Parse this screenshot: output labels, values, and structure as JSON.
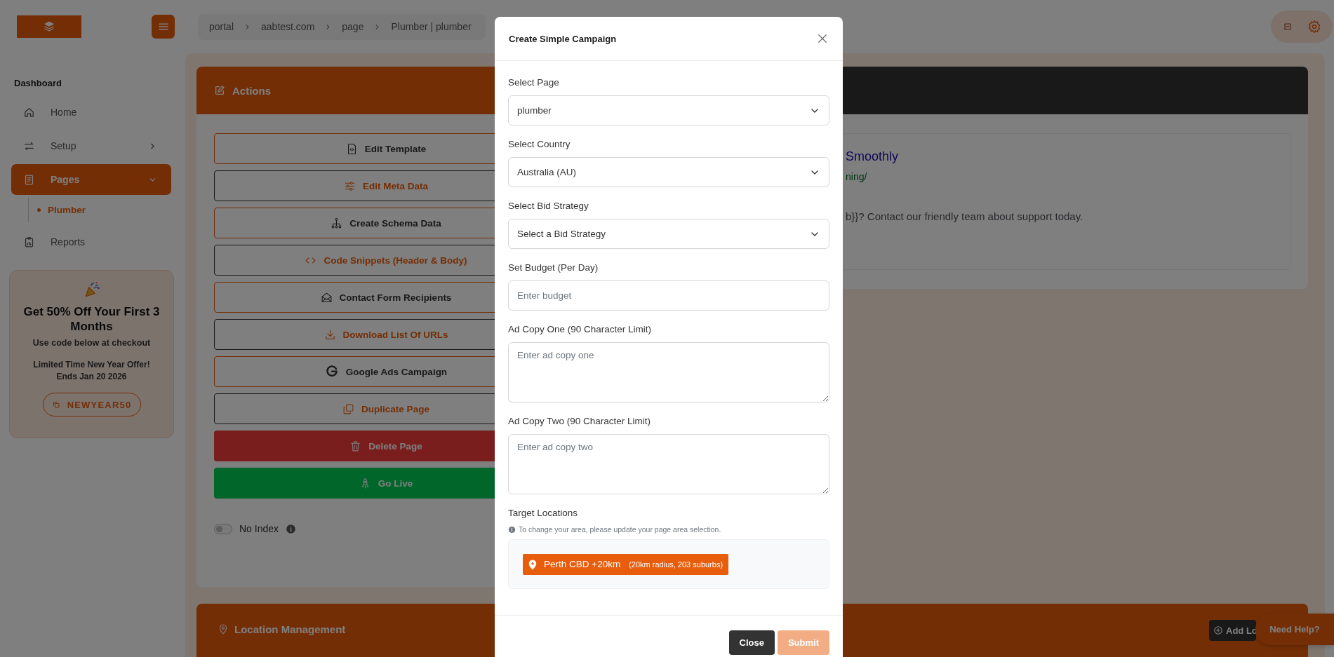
{
  "topbar": {
    "breadcrumb": [
      "portal",
      "aabtest.com",
      "page",
      "Plumber | plumber"
    ]
  },
  "sidebar": {
    "section": "Dashboard",
    "items": [
      {
        "label": "Home",
        "kind": "link",
        "selected": false
      },
      {
        "label": "Setup",
        "kind": "group",
        "selected": false,
        "expanded": false
      },
      {
        "label": "Pages",
        "kind": "group",
        "selected": true,
        "expanded": true,
        "children": [
          {
            "label": "Plumber",
            "selected": true
          }
        ]
      },
      {
        "label": "Reports",
        "kind": "link",
        "selected": false
      }
    ]
  },
  "promo": {
    "title": "Get 50% Off Your First 3 Months",
    "subtitle": "Use code below at checkout",
    "offer": "Limited Time New Year Offer!",
    "ends": "Ends Jan 20 2026",
    "code": "NEWYEAR50"
  },
  "actions": {
    "title": "Actions",
    "buttons": [
      {
        "label": "Edit Template",
        "kind": "primary"
      },
      {
        "label": "Edit Meta Data",
        "kind": "secondary"
      },
      {
        "label": "Create Schema Data",
        "kind": "primary"
      },
      {
        "label": "Code Snippets (Header & Body)",
        "kind": "secondary"
      },
      {
        "label": "Contact Form Recipients",
        "kind": "primary"
      },
      {
        "label": "Download List Of URLs",
        "kind": "secondary"
      },
      {
        "label": "Google Ads Campaign",
        "kind": "primary"
      },
      {
        "label": "Duplicate Page",
        "kind": "secondary"
      },
      {
        "label": "Delete Page",
        "kind": "danger"
      },
      {
        "label": "Go Live",
        "kind": "success"
      }
    ],
    "no_index": {
      "label": "No Index",
      "on": false
    }
  },
  "preview": {
    "title": "Smoothly",
    "url": "ning/",
    "description": "b}}? Contact our friendly team about support today."
  },
  "location_management": {
    "title": "Location Management",
    "add_button": "Add Lo"
  },
  "help_button": "Need Help?",
  "modal": {
    "title": "Create Simple Campaign",
    "fields": [
      {
        "kind": "select",
        "label": "Select Page",
        "value": "plumber"
      },
      {
        "kind": "select",
        "label": "Select Country",
        "value": "Australia (AU)"
      },
      {
        "kind": "select",
        "label": "Select Bid Strategy",
        "value": "Select a Bid Strategy"
      },
      {
        "kind": "input",
        "label": "Set Budget (Per Day)",
        "placeholder": "Enter budget"
      },
      {
        "kind": "textarea",
        "label": "Ad Copy One (90 Character Limit)",
        "placeholder": "Enter ad copy one"
      },
      {
        "kind": "textarea",
        "label": "Ad Copy Two (90 Character Limit)",
        "placeholder": "Enter ad copy two"
      }
    ],
    "target_locations": {
      "label": "Target Locations",
      "hint": "To change your area, please update your page area selection.",
      "locations": [
        {
          "name": "Perth CBD +20km",
          "detail": "(20km radius, 203 suburbs)"
        }
      ]
    },
    "buttons": [
      {
        "label": "Close",
        "kind": "secondary",
        "disabled": false
      },
      {
        "label": "Submit",
        "kind": "primary",
        "disabled": true
      }
    ]
  }
}
